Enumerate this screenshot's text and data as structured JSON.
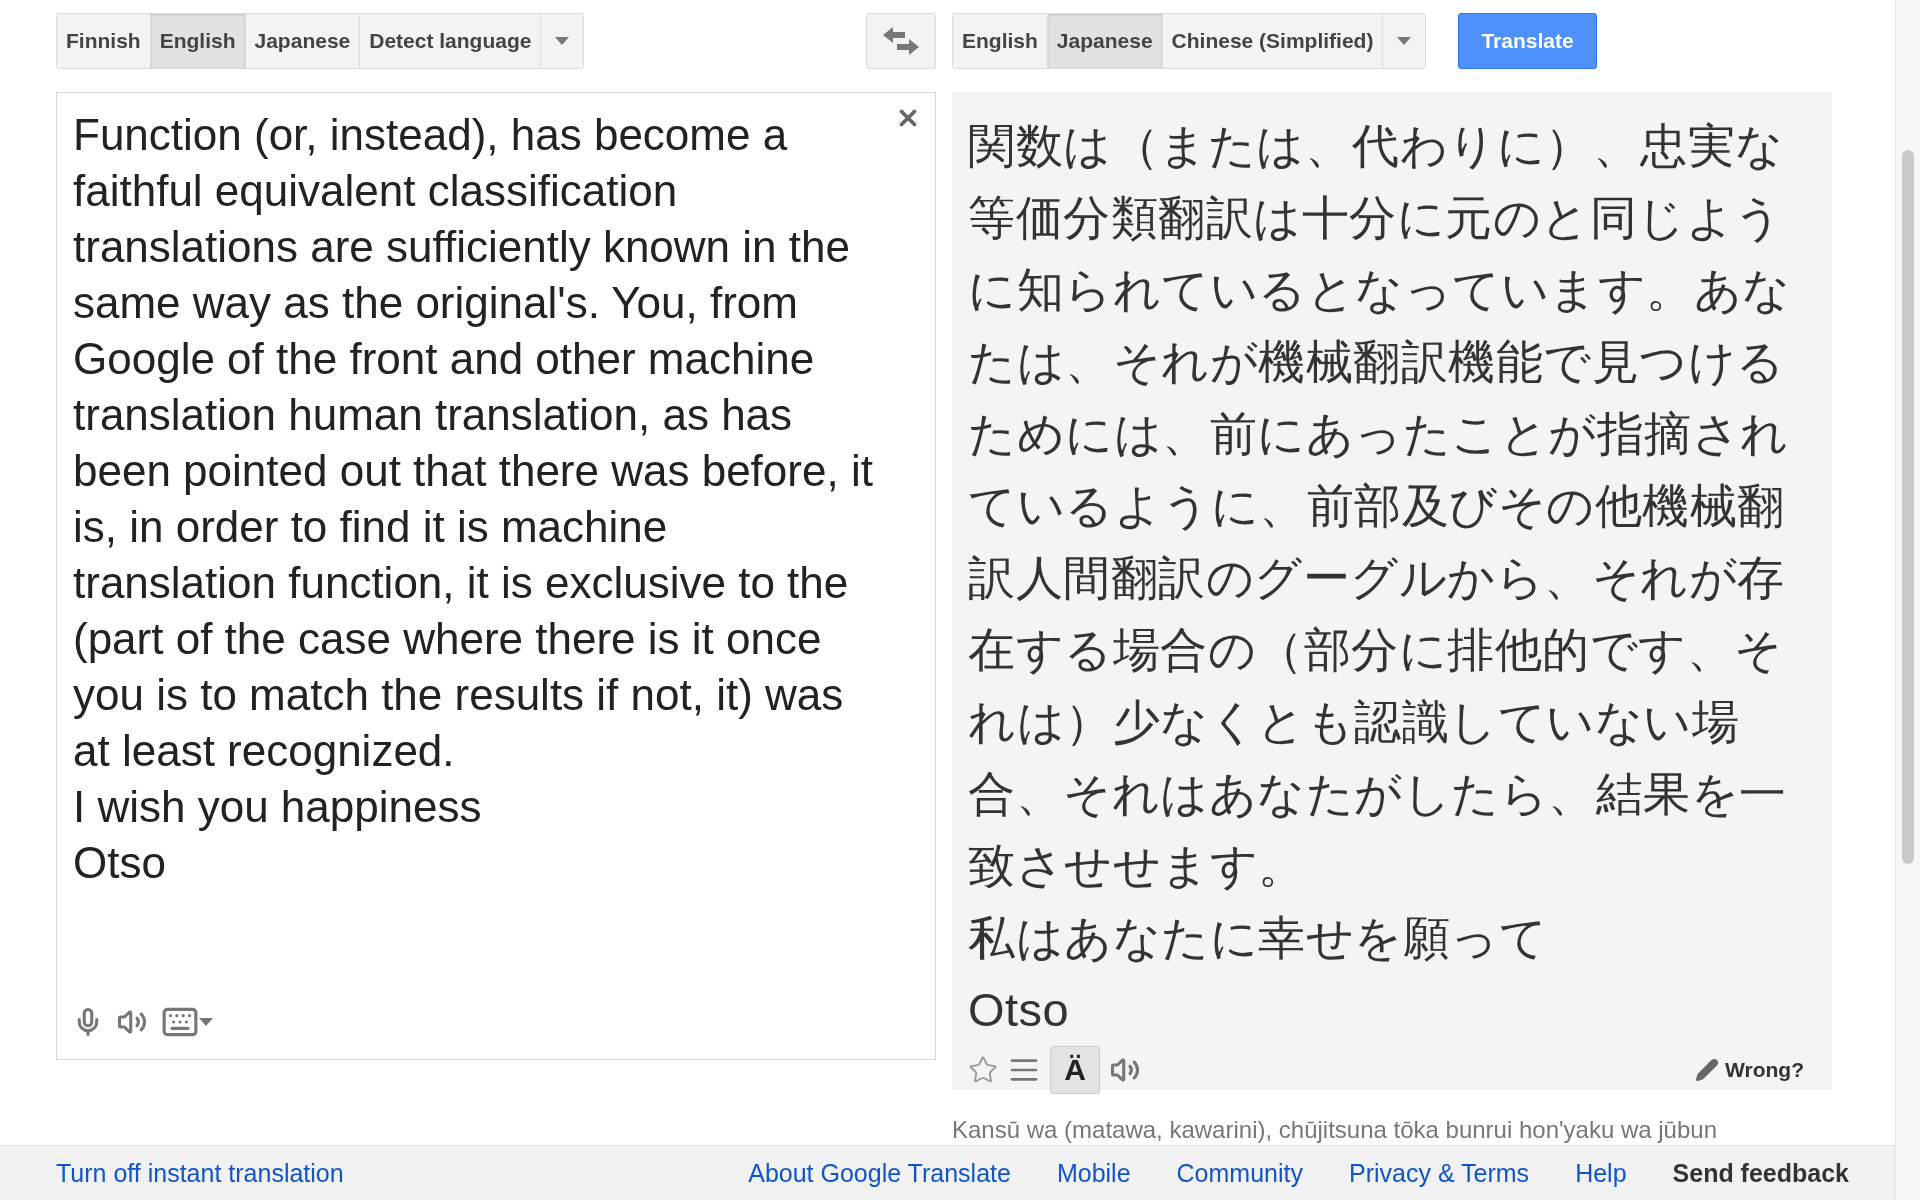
{
  "source_languages": [
    {
      "label": "Finnish",
      "selected": false
    },
    {
      "label": "English",
      "selected": true
    },
    {
      "label": "Japanese",
      "selected": false
    },
    {
      "label": "Detect language",
      "selected": false
    }
  ],
  "target_languages": [
    {
      "label": "English",
      "selected": false
    },
    {
      "label": "Japanese",
      "selected": true
    },
    {
      "label": "Chinese (Simplified)",
      "selected": false
    }
  ],
  "translate_button": "Translate",
  "source": {
    "paragraphs": [
      "Function (or, instead), has become a faithful equivalent classification translations are sufficiently known in the same way as the original's. You, from Google of the front and other machine translation human translation, as has been pointed out that there was before, it is, in order to find it is machine translation function, it is exclusive to the (part of the case where there is it once you is to match the results if not, it) was at least recognized.",
      "I wish you happiness",
      "Otso"
    ]
  },
  "result": {
    "paragraphs": [
      "関数は（または、代わりに）、忠実な等価分類翻訳は十分に元のと同じように知られているとなっています。あなたは、それが機械翻訳機能で見つけるためには、前にあったことが指摘されているように、前部及びその他機械翻訳人間翻訳のグーグルから、それが存在する場合の（部分に排他的です、それは）少なくとも認識していない場合、それはあなたがしたら、結果を一致させせます。",
      "私はあなたに幸せを願って",
      "Otso"
    ],
    "romanize_button": {
      "label": "Ä",
      "selected": true
    },
    "wrong_link": "Wrong?",
    "romanization": "Kansū wa (matawa, kawarini), chūjitsuna tōka bunrui hon'yaku wa jūbun"
  },
  "footer": {
    "left_link": "Turn off instant translation",
    "links": [
      "About Google Translate",
      "Mobile",
      "Community",
      "Privacy & Terms",
      "Help"
    ],
    "feedback": "Send feedback"
  }
}
